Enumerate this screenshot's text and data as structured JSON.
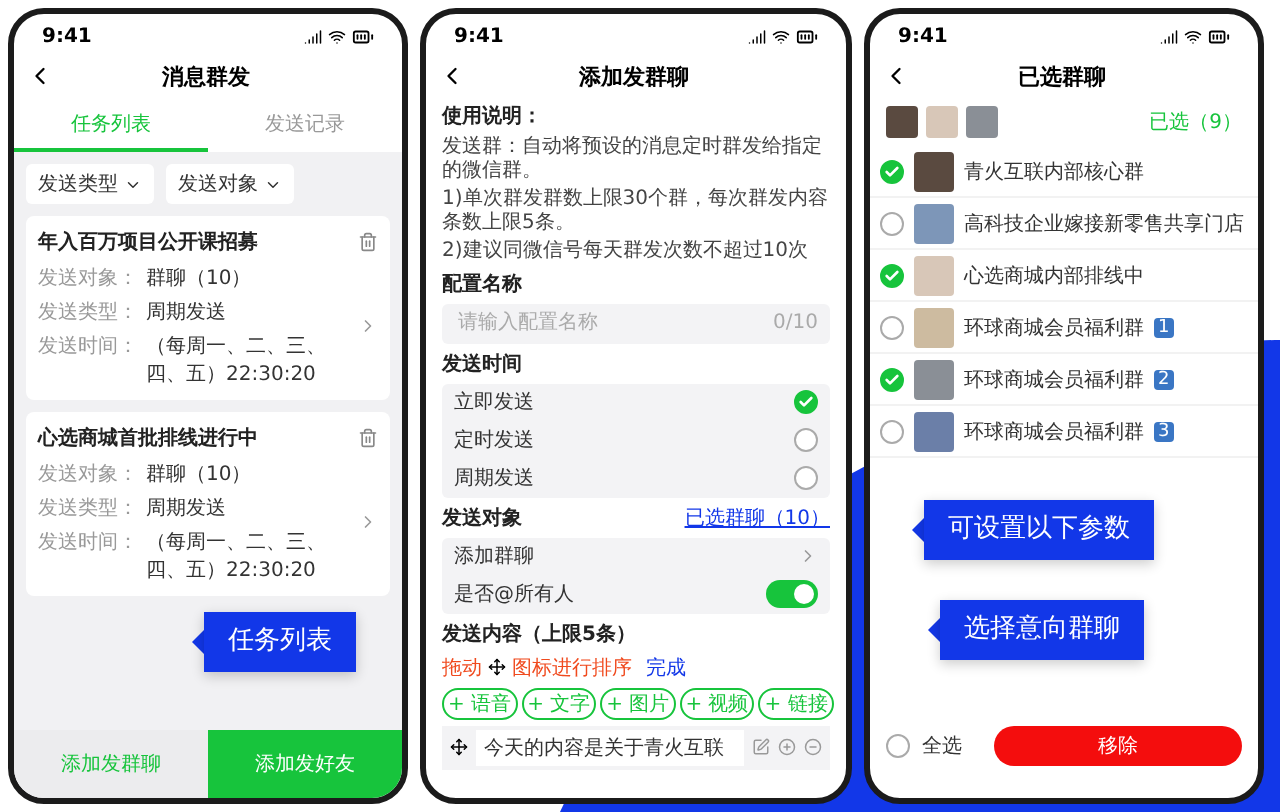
{
  "callouts": [
    {
      "text": "任务列表"
    },
    {
      "text": "可设置以下参数"
    },
    {
      "text": "选择意向群聊"
    }
  ],
  "task_screen": {
    "time": "9:41",
    "title": "消息群发",
    "tabs": [
      {
        "label": "任务列表",
        "selected": true
      },
      {
        "label": "发送记录",
        "selected": false
      }
    ],
    "filters": [
      {
        "label": "发送类型"
      },
      {
        "label": "发送对象"
      }
    ],
    "tasks": [
      {
        "title": "年入百万项目公开课招募",
        "fields": [
          {
            "label": "发送对象：",
            "value": "群聊（10）"
          },
          {
            "label": "发送类型：",
            "value": "周期发送"
          },
          {
            "label": "发送时间：",
            "value": "（每周一、二、三、四、五）22:30:20"
          }
        ]
      },
      {
        "title": "心选商城首批排线进行中",
        "fields": [
          {
            "label": "发送对象：",
            "value": "群聊（10）"
          },
          {
            "label": "发送类型：",
            "value": "周期发送"
          },
          {
            "label": "发送时间：",
            "value": "（每周一、二、三、四、五）22:30:20"
          }
        ]
      }
    ],
    "buttons": [
      {
        "label": "添加发群聊",
        "kind": "secondary"
      },
      {
        "label": "添加发好友",
        "kind": "primary"
      }
    ]
  },
  "add_group_screen": {
    "time": "9:41",
    "title": "添加发群聊",
    "instructions": {
      "heading": "使用说明：",
      "lines": [
        "发送群：自动将预设的消息定时群发给指定的微信群。",
        "1)单次群发群数上限30个群，每次群发内容条数上限5条。",
        "2)建议同微信号每天群发次数不超过10次"
      ]
    },
    "name_field": {
      "label": "配置名称",
      "placeholder": "请输入配置名称",
      "counter": "0/10"
    },
    "send_time": {
      "label": "发送时间",
      "options": [
        {
          "label": "立即发送",
          "selected": true
        },
        {
          "label": "定时发送",
          "selected": false
        },
        {
          "label": "周期发送",
          "selected": false
        }
      ]
    },
    "target": {
      "label": "发送对象",
      "link": "已选群聊（10）",
      "add_row": "添加群聊",
      "mention": {
        "label": "是否@所有人",
        "on": true
      }
    },
    "content": {
      "label": "发送内容（上限5条）",
      "hint_drag": "拖动",
      "hint_sort": "图标进行排序",
      "done": "完成",
      "chips": [
        "+ 语音",
        "+ 文字",
        "+ 图片",
        "+ 视频",
        "+ 链接"
      ],
      "items": [
        {
          "text": "今天的内容是关于青火互联"
        }
      ]
    }
  },
  "selected_screen": {
    "time": "9:41",
    "title": "已选群聊",
    "count": "已选（9）",
    "groups": [
      {
        "name": "青火互联内部核心群",
        "selected": true
      },
      {
        "name": "高科技企业嫁接新零售共享门店",
        "selected": false
      },
      {
        "name": "心选商城内部排线中",
        "selected": true
      },
      {
        "name": "环球商城会员福利群",
        "badge": "1",
        "selected": false
      },
      {
        "name": "环球商城会员福利群",
        "badge": "2",
        "selected": true
      },
      {
        "name": "环球商城会员福利群",
        "badge": "3",
        "selected": false
      }
    ],
    "select_all": {
      "label": "全选",
      "checked": false
    },
    "remove": "移除"
  }
}
